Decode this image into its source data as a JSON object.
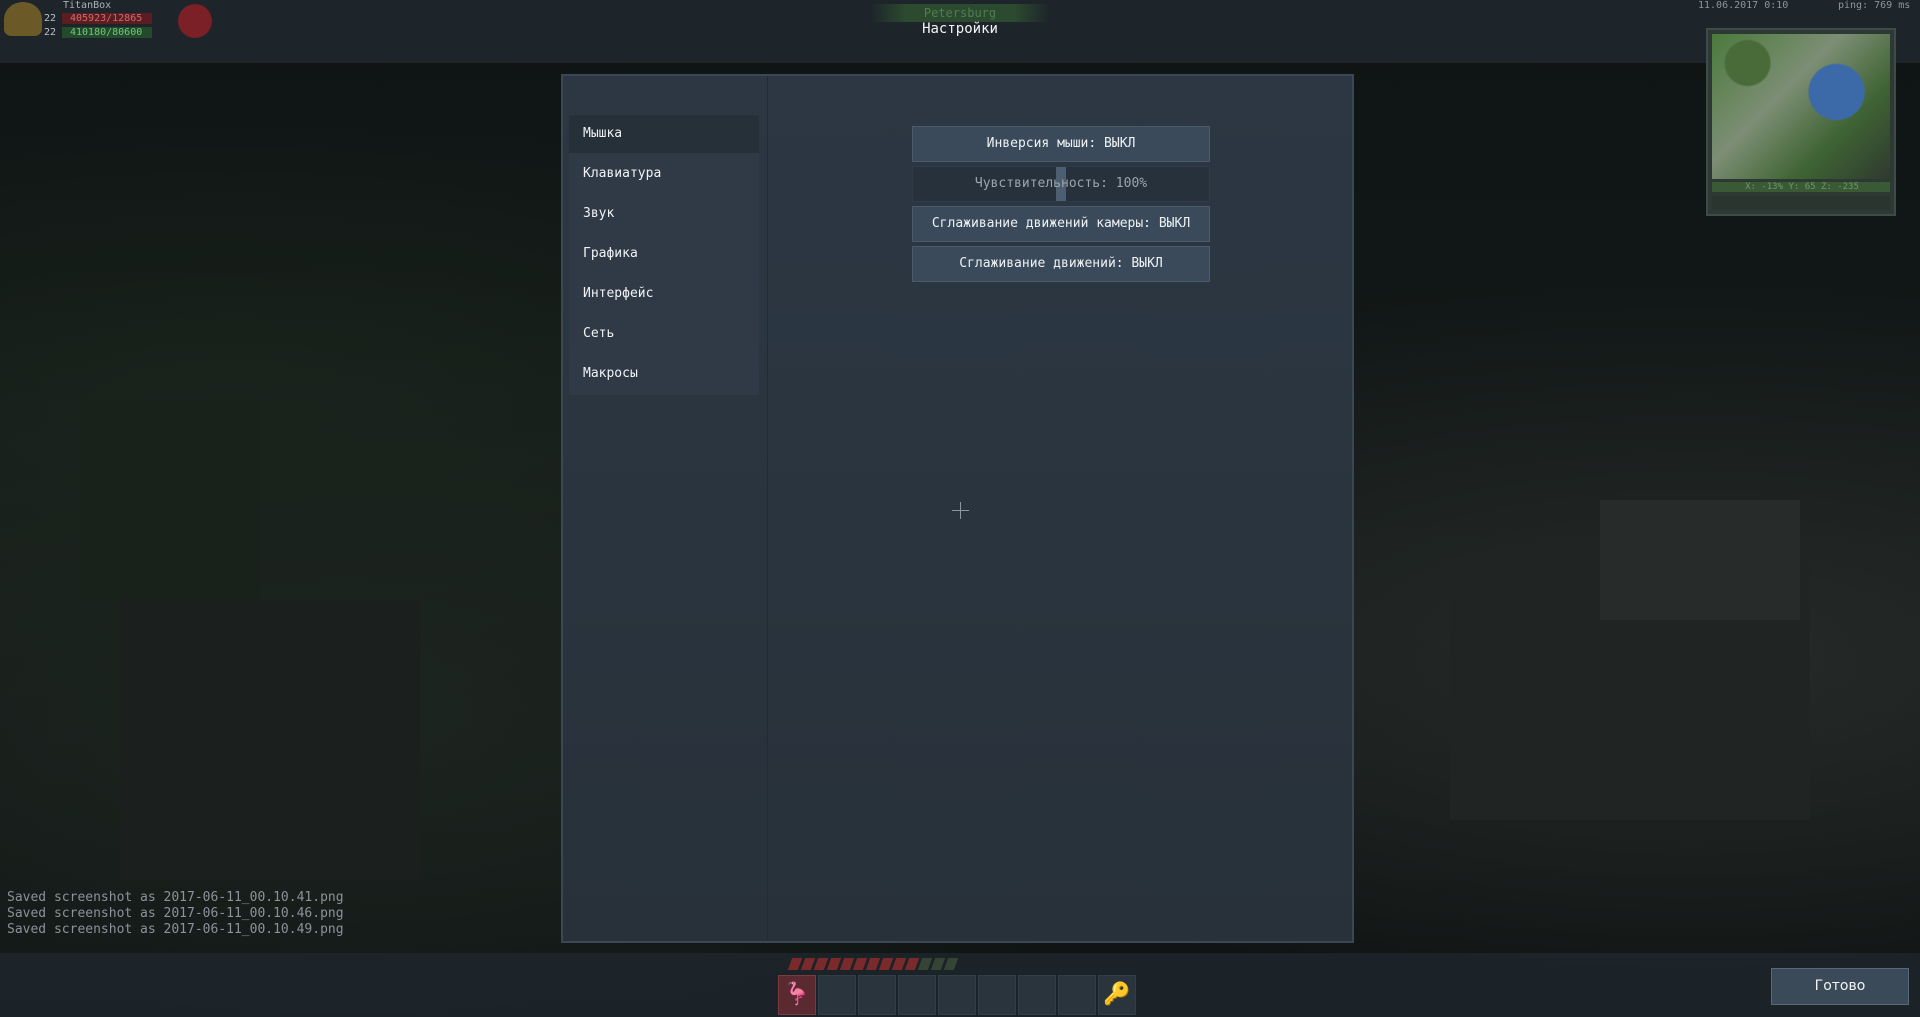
{
  "hud": {
    "player_name": "TitanBox",
    "health_level": "22",
    "health_value": "405923/12865",
    "xp_level": "22",
    "xp_value": "410180/80600",
    "server": "Petersburg",
    "datetime": "11.06.2017 0:10",
    "ping": "ping: 769 ms",
    "minimap_coords": "X: -13% Y: 65 Z: -235"
  },
  "page": {
    "title": "Настройки"
  },
  "sidebar": {
    "items": [
      {
        "label": "Мышка",
        "active": true
      },
      {
        "label": "Клавиатура",
        "active": false
      },
      {
        "label": "Звук",
        "active": false
      },
      {
        "label": "Графика",
        "active": false
      },
      {
        "label": "Интерфейс",
        "active": false
      },
      {
        "label": "Сеть",
        "active": false
      },
      {
        "label": "Макросы",
        "active": false
      }
    ]
  },
  "options": {
    "invert_mouse": "Инверсия мыши: ВЫКЛ",
    "sensitivity": "Чувствительность: 100%",
    "sensitivity_value": 1.0,
    "camera_smoothing": "Сглаживание движений камеры: ВЫКЛ",
    "smoothing": "Сглаживание движений: ВЫКЛ"
  },
  "chat": {
    "lines": [
      "Saved screenshot as 2017-06-11_00.10.41.png",
      "Saved screenshot as 2017-06-11_00.10.46.png",
      "Saved screenshot as 2017-06-11_00.10.49.png"
    ]
  },
  "footer": {
    "done_label": "Готово"
  },
  "icons": {
    "helmet": "helmet-icon",
    "badge": "player-badge-icon",
    "hotbar_first": "flamingo-icon",
    "hotbar_last": "key-icon"
  },
  "colors": {
    "panel": "#2a3540",
    "button": "#3a4a5a",
    "health": "#5a1e22",
    "xp": "#234a2a"
  }
}
